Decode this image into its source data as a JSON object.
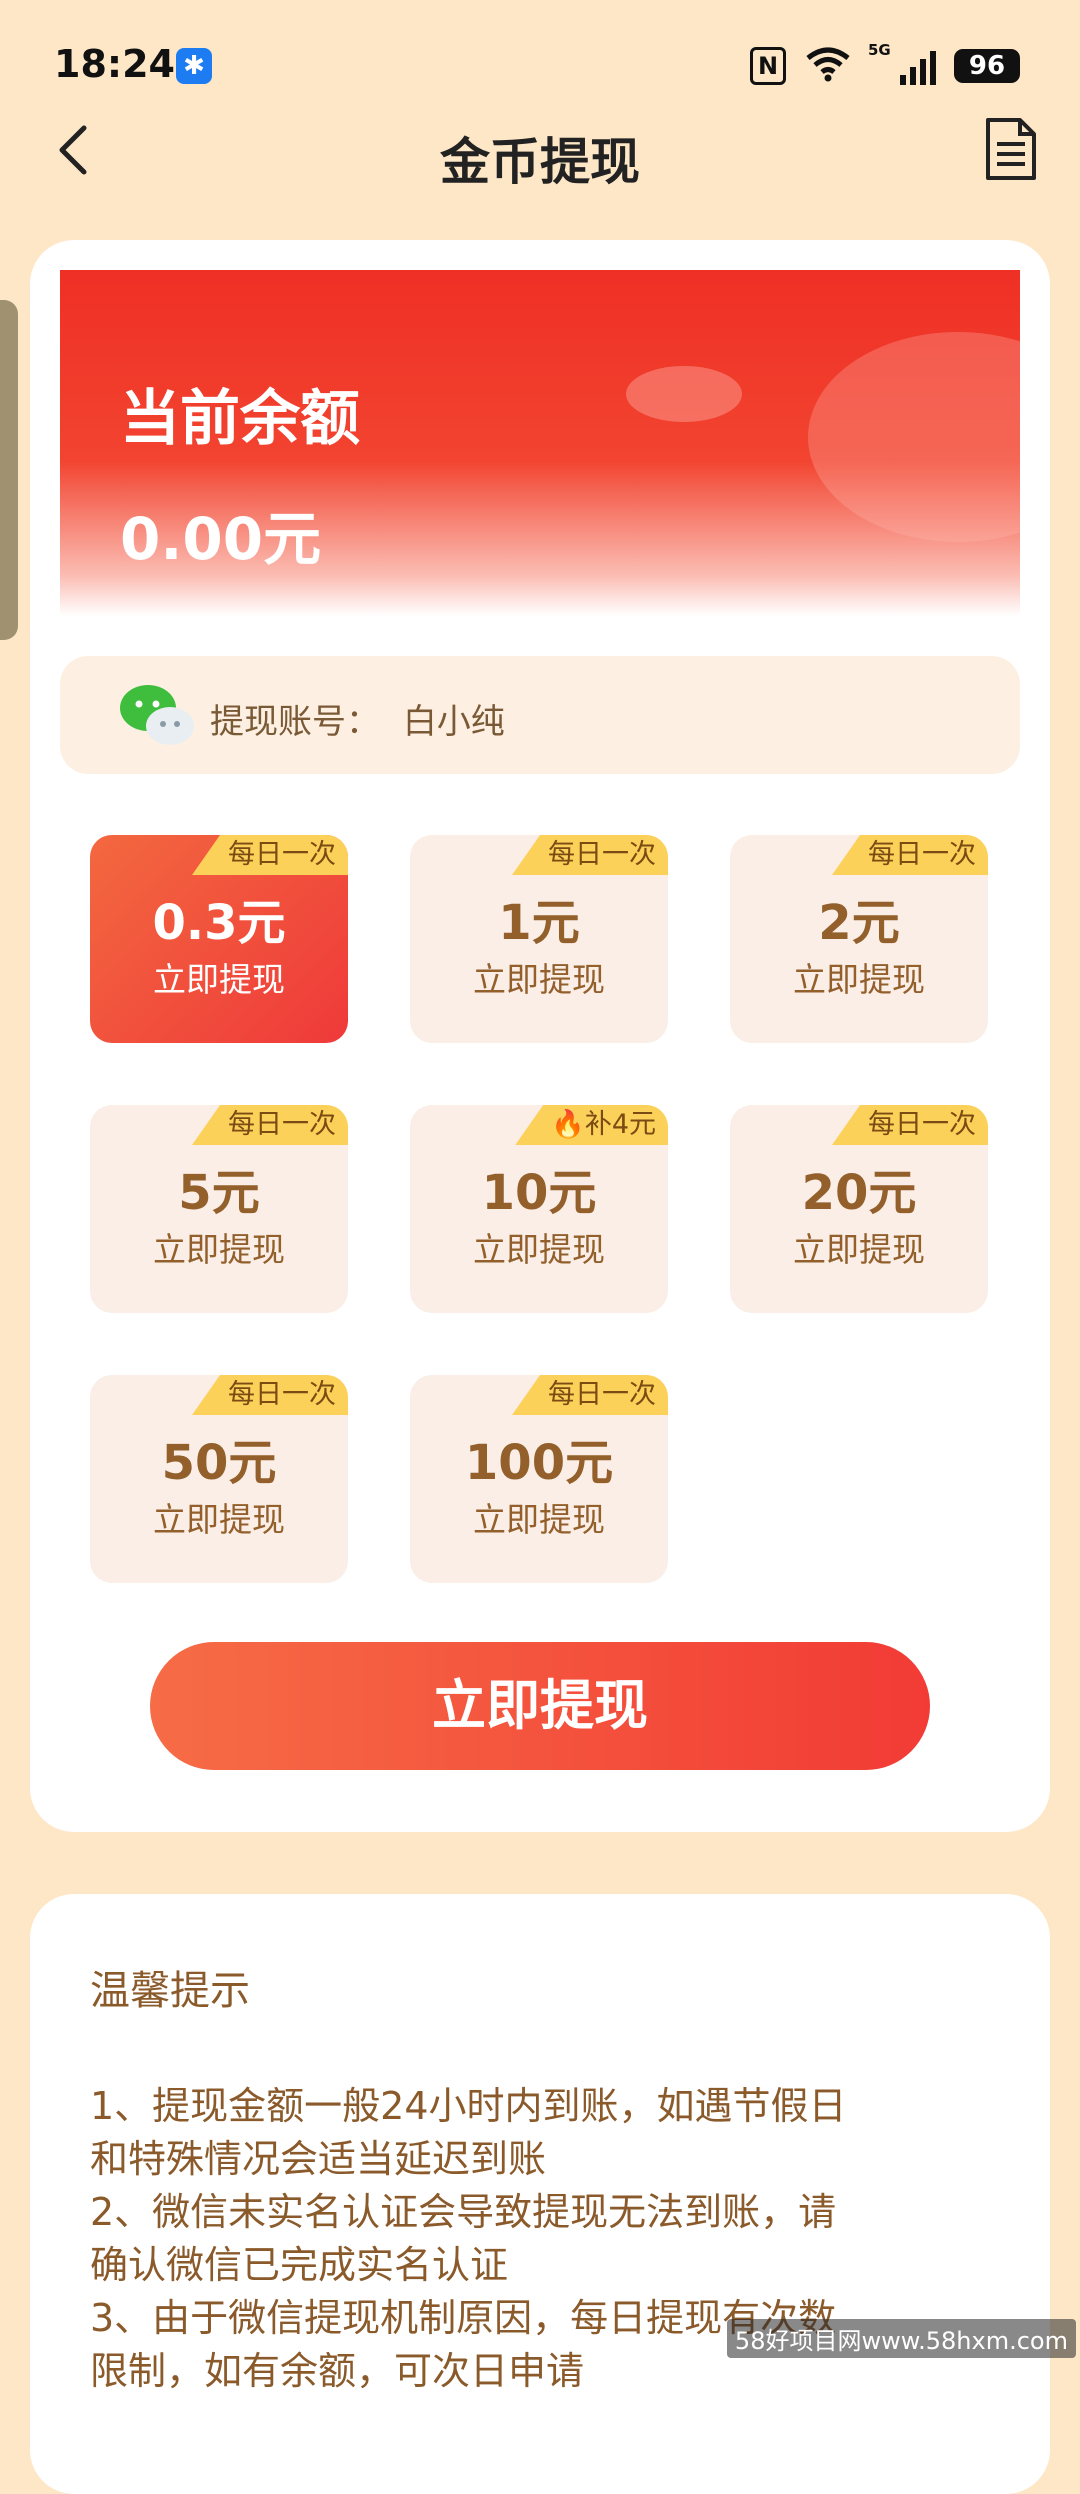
{
  "status_bar": {
    "time": "18:24",
    "network": "5G",
    "battery": "96"
  },
  "header": {
    "title": "金币提现"
  },
  "balance": {
    "label": "当前余额",
    "value": "0.00元"
  },
  "account": {
    "label": "提现账号：",
    "name": "白小纯"
  },
  "options": [
    {
      "tag": "每日一次",
      "amount": "0.3元",
      "action": "立即提现",
      "selected": true
    },
    {
      "tag": "每日一次",
      "amount": "1元",
      "action": "立即提现"
    },
    {
      "tag": "每日一次",
      "amount": "2元",
      "action": "立即提现"
    },
    {
      "tag": "每日一次",
      "amount": "5元",
      "action": "立即提现"
    },
    {
      "tag": "🔥补4元",
      "amount": "10元",
      "action": "立即提现"
    },
    {
      "tag": "每日一次",
      "amount": "20元",
      "action": "立即提现"
    },
    {
      "tag": "每日一次",
      "amount": "50元",
      "action": "立即提现"
    },
    {
      "tag": "每日一次",
      "amount": "100元",
      "action": "立即提现"
    }
  ],
  "withdraw_button": "立即提现",
  "tips": {
    "title": "温馨提示",
    "lines": [
      "1、提现金额一般24小时内到账，如遇节假日",
      "和特殊情况会适当延迟到账",
      "2、微信未实名认证会导致提现无法到账，请",
      "确认微信已完成实名认证",
      "3、由于微信提现机制原因，每日提现有次数",
      "限制，如有余额，可次日申请"
    ]
  },
  "watermark": "58好项目网www.58hxm.com",
  "colors": {
    "accent": "#f23b35",
    "background": "#fde7c7",
    "text_brown": "#93602c",
    "tag_yellow": "#fcd15a"
  }
}
